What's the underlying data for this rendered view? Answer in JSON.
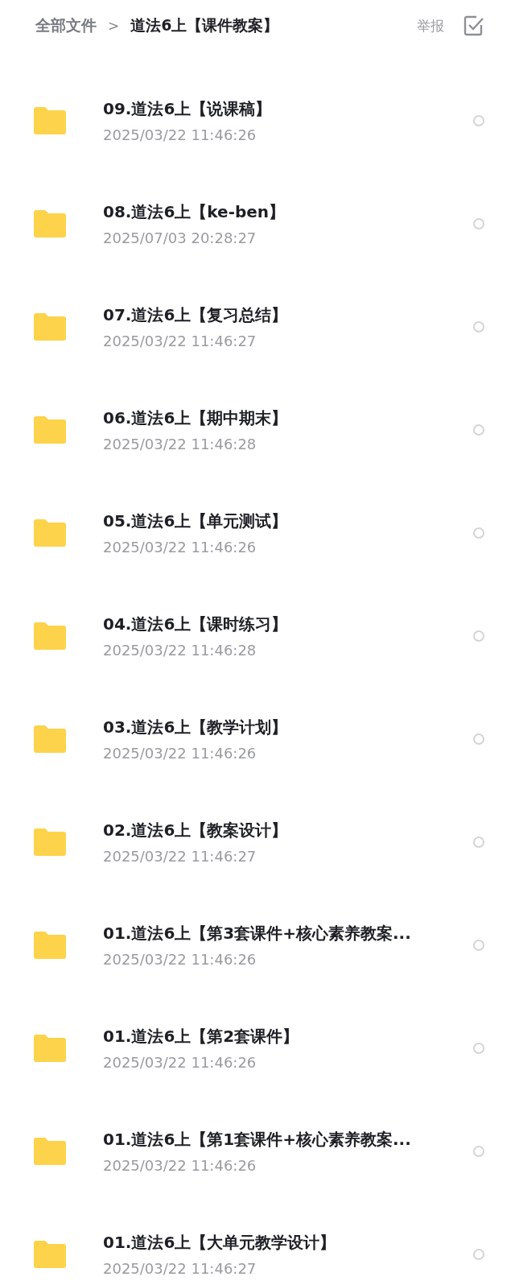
{
  "breadcrumb": {
    "root": "全部文件",
    "separator": ">",
    "current": "道法6上【课件教案】"
  },
  "header_actions": {
    "report": "举报"
  },
  "files": [
    {
      "name": "09.道法6上【说课稿】",
      "date": "2025/03/22 11:46:26",
      "selected": false
    },
    {
      "name": "08.道法6上【ke-ben】",
      "date": "2025/07/03 20:28:27",
      "selected": false
    },
    {
      "name": "07.道法6上【复习总结】",
      "date": "2025/03/22 11:46:27",
      "selected": false
    },
    {
      "name": "06.道法6上【期中期末】",
      "date": "2025/03/22 11:46:28",
      "selected": false
    },
    {
      "name": "05.道法6上【单元测试】",
      "date": "2025/03/22 11:46:26",
      "selected": false
    },
    {
      "name": "04.道法6上【课时练习】",
      "date": "2025/03/22 11:46:28",
      "selected": false
    },
    {
      "name": "03.道法6上【教学计划】",
      "date": "2025/03/22 11:46:26",
      "selected": false
    },
    {
      "name": "02.道法6上【教案设计】",
      "date": "2025/03/22 11:46:27",
      "selected": false
    },
    {
      "name": "01.道法6上【第3套课件+核心素养教案...",
      "date": "2025/03/22 11:46:26",
      "selected": false
    },
    {
      "name": "01.道法6上【第2套课件】",
      "date": "2025/03/22 11:46:26",
      "selected": false
    },
    {
      "name": "01.道法6上【第1套课件+核心素养教案...",
      "date": "2025/03/22 11:46:26",
      "selected": false
    },
    {
      "name": "01.道法6上【大单元教学设计】",
      "date": "2025/03/22 11:46:27",
      "selected": false
    }
  ]
}
